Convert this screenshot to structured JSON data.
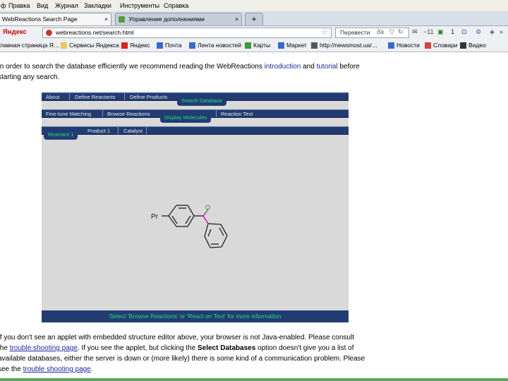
{
  "menubar": [
    "ф",
    "Правка",
    "Вид",
    "Журнал",
    "Закладки",
    "Инструменты",
    "Справка"
  ],
  "tabs": [
    {
      "label": "WebReactions Search Page",
      "active": true
    },
    {
      "label": "Управление дополнениями",
      "active": false
    }
  ],
  "new_tab_label": "+",
  "navbar": {
    "yandex_label": "Яндекс",
    "url": "webreactions.net/search.html",
    "search_text": "Перевести",
    "bookmark_count": "1"
  },
  "bookmarks": [
    "Главная страница Я…",
    "Сервисы Яндекса",
    "Яндекс",
    "Почта",
    "Лента новостей",
    "Карты",
    "Маркет",
    "http://newsmost.ua/…",
    "Новости",
    "Словари",
    "Видео"
  ],
  "content": {
    "intro_part1": "In order to search the database efficiently we recommend reading the WebReactions ",
    "intro_link1": "introduction",
    "intro_and": " and ",
    "intro_link2": "tutorial",
    "intro_part2": " before",
    "intro_line2": "starting any search.",
    "p2_line1": "If you don't see an applet with embedded structure editor above, your browser is not Java-enabled. Please consult",
    "p2_line2_pre": "the ",
    "p2_line2_link": "trouble shooting page",
    "p2_line2_mid": ". If you see the applet, but clicking the ",
    "p2_line2_bold": "Select Databases",
    "p2_line2_post": " option doesn't give you a list of",
    "p2_line3": "available databases, either the server is down or (more likely) there is some kind of a communication problem. Please",
    "p2_line4_pre": "see the ",
    "p2_line4_link": "trouble shooting page",
    "p2_line4_post": "."
  },
  "applet": {
    "row1_items": [
      "About",
      "Define Reactants",
      "Define Products"
    ],
    "row1_tab": "Search Database",
    "row2_items": [
      "Fine-tune Matching",
      "Browse Reactions",
      "Reaction Text"
    ],
    "row2_tab": "Display Molecules",
    "row3_items": [
      "Product 1",
      "Catalyst"
    ],
    "row3_tab": "Reactant 1",
    "molecule_label_pr": "Pr",
    "molecule_label_o": "O",
    "footer": "Select 'Browse Reactions' or 'React on Text' for more information"
  },
  "colors": {
    "applet_nav": "#223c73",
    "applet_accent": "#1fe07a",
    "link": "#1a2a9c"
  }
}
